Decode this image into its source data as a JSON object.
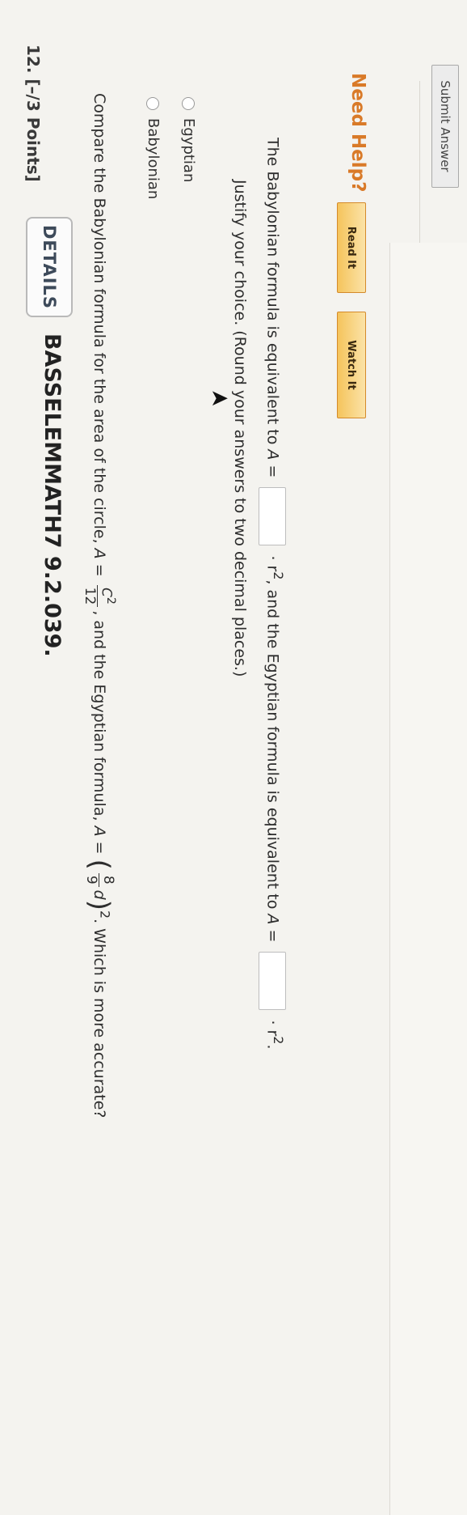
{
  "question": {
    "number_points": "12. [–/3 Points]",
    "details_label": "DETAILS",
    "course_code": "BASSELEMMATH7 9.2.039."
  },
  "prompt": {
    "part1": "Compare the Babylonian formula for the area of the circle, ",
    "babylonian_lhs": "A = ",
    "babylonian_num": "C",
    "babylonian_exp": "2",
    "babylonian_den": "12",
    "part2": ", and the Egyptian formula, ",
    "egyptian_lhs": "A = ",
    "egyptian_num": "8",
    "egyptian_den": "9",
    "egyptian_var": "d",
    "egyptian_exp": "2",
    "part3": ". Which is more accurate?"
  },
  "options": [
    {
      "label": "Babylonian"
    },
    {
      "label": "Egyptian"
    }
  ],
  "justify": "Justify your choice. (Round your answers to two decimal places.)",
  "equivalence": {
    "part1": "The Babylonian formula is equivalent to ",
    "var1": "A = ",
    "part2": " · r",
    "exp": "2",
    "part3": ", and the Egyptian formula is equivalent to ",
    "var2": "A = ",
    "part4": " · r",
    "exp2": "2",
    "end": "."
  },
  "help": {
    "label": "Need Help?",
    "read_it": "Read It",
    "watch_it": "Watch It"
  },
  "submit_label": "Submit Answer",
  "colors": {
    "accent": "#d97a28",
    "button_fill": "#f5c45c"
  }
}
